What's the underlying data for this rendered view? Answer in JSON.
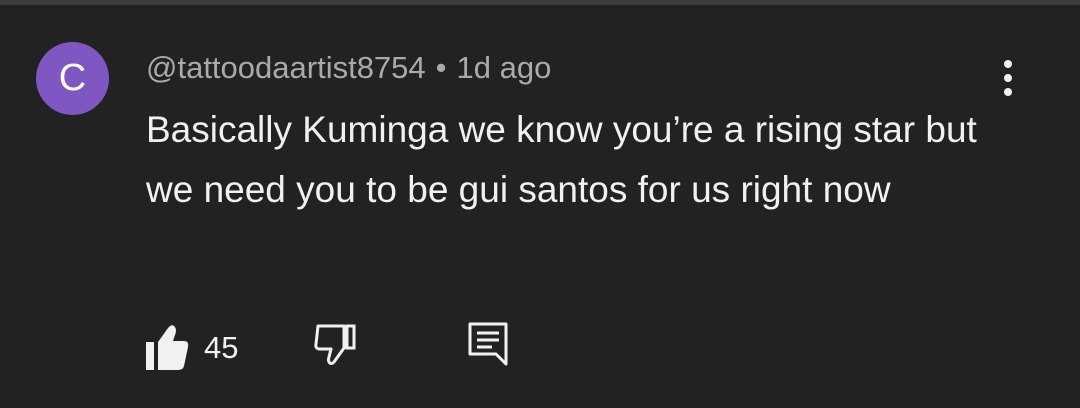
{
  "comment": {
    "avatar_letter": "C",
    "avatar_color": "#7e57c2",
    "author": "@tattoodaartist8754",
    "separator": "•",
    "time": "1d ago",
    "text": "Basically Kuminga we know you’re a rising star but we need you to be gui santos for us right now",
    "like_count": "45"
  },
  "icons": {
    "menu": "more-vert-icon",
    "like": "thumb-up-icon",
    "dislike": "thumb-down-icon",
    "reply": "comment-icon"
  }
}
